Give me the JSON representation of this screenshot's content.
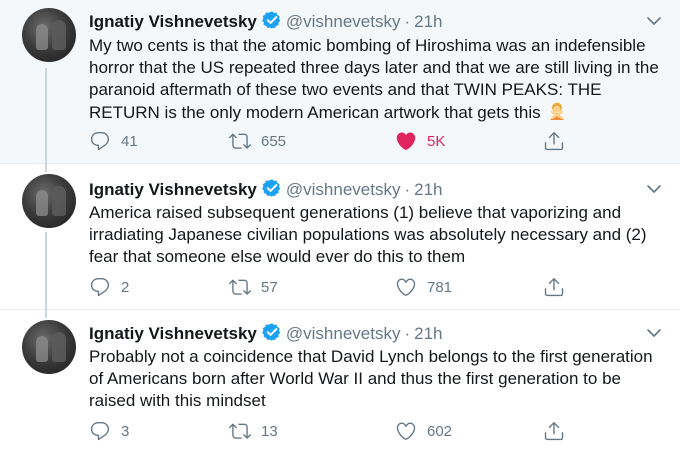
{
  "tweets": [
    {
      "author": "Ignatiy Vishnevetsky",
      "handle": "@vishnevetsky",
      "separator": "·",
      "time": "21h",
      "text": "My two cents is that the atomic bombing of Hiroshima was an indefensible horror that the US repeated three days later and that we are still living in the paranoid aftermath of these two events and that TWIN PEAKS: THE RETURN is the only modern American artwork that gets this",
      "emoji": "person-gesturing-no-emoji",
      "replies": "41",
      "retweets": "655",
      "likes": "5K",
      "liked": true
    },
    {
      "author": "Ignatiy Vishnevetsky",
      "handle": "@vishnevetsky",
      "separator": "·",
      "time": "21h",
      "text": "America raised subsequent generations (1) believe that vaporizing and irradiating Japanese civilian populations was absolutely necessary and (2) fear that someone else would ever do this to them",
      "replies": "2",
      "retweets": "57",
      "likes": "781",
      "liked": false
    },
    {
      "author": "Ignatiy Vishnevetsky",
      "handle": "@vishnevetsky",
      "separator": "·",
      "time": "21h",
      "text": "Probably not a coincidence that David Lynch belongs to the first generation of Americans born after World War II and thus the first generation to be raised with this mindset",
      "replies": "3",
      "retweets": "13",
      "likes": "602",
      "liked": false
    }
  ],
  "colors": {
    "text": "#14171a",
    "muted": "#657786",
    "verified": "#1da1f2",
    "like": "#e0245e",
    "highlight_bg": "#f5f8fa",
    "thread_line": "#ccd6dd"
  },
  "icons": [
    "reply-icon",
    "retweet-icon",
    "like-icon",
    "share-icon",
    "verified-badge-icon",
    "chevron-down-icon"
  ]
}
